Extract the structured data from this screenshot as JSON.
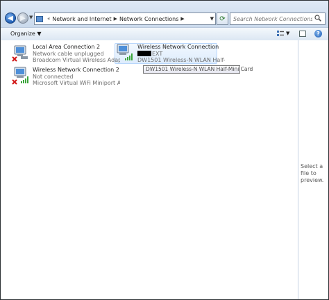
{
  "address_bar": {
    "crumbs": [
      "Network and Internet",
      "Network Connections"
    ]
  },
  "search": {
    "placeholder": "Search Network Connections"
  },
  "command_bar": {
    "organize_label": "Organize"
  },
  "connections": [
    {
      "name": "Local Area Connection 2",
      "status": "Network cable unplugged",
      "device": "Broadcom Virtual Wireless Adapter",
      "icon": "wired-network-icon",
      "error": true
    },
    {
      "name": "Wireless Network Connection",
      "status": "EXT",
      "device": "DW1501 Wireless-N WLAN Half-...",
      "icon": "wireless-network-icon",
      "error": false
    },
    {
      "name": "Wireless Network Connection 2",
      "status": "Not connected",
      "device": "Microsoft Virtual WiFi Miniport A...",
      "icon": "wireless-network-icon",
      "error": true
    }
  ],
  "tooltip": {
    "text": "DW1501 Wireless-N WLAN Half-Mini Card"
  },
  "preview_pane": {
    "message": "Select a file to preview."
  },
  "colors": {
    "accent": "#1f5fb6",
    "signal": "#3aa53a",
    "error": "#d21a1a"
  }
}
